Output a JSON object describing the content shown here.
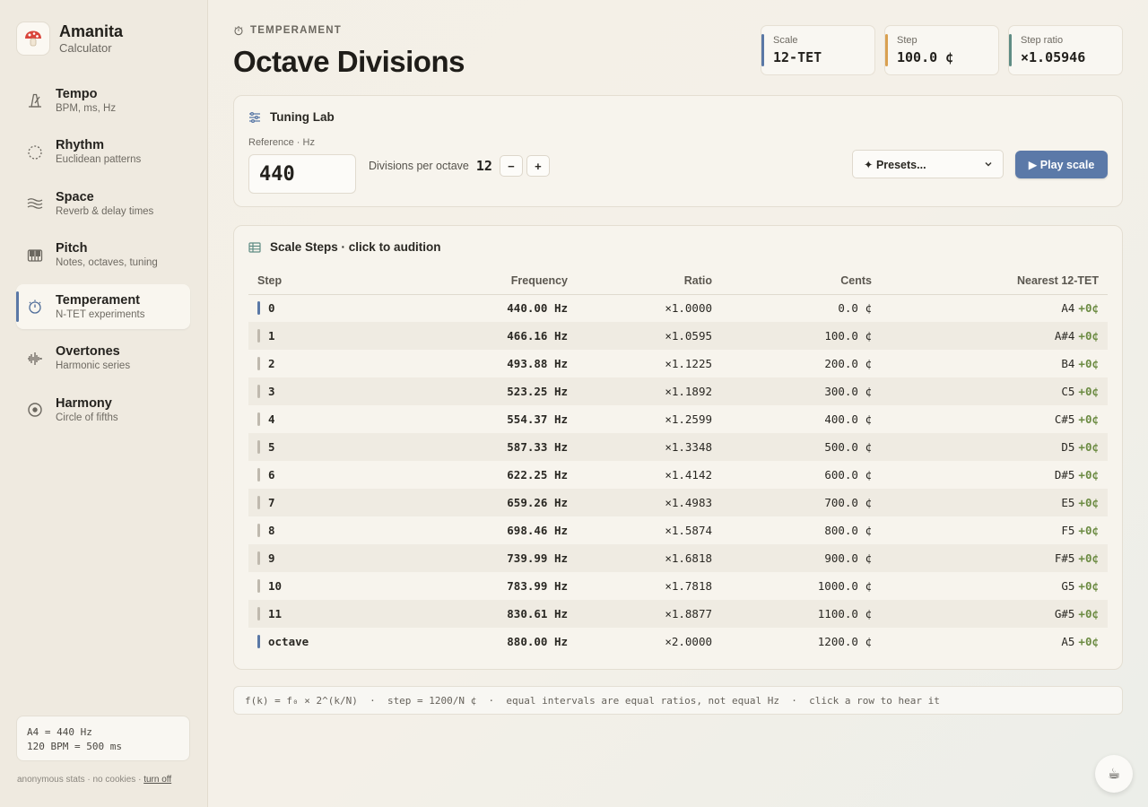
{
  "brand": {
    "name": "Amanita",
    "subtitle": "Calculator"
  },
  "nav": [
    {
      "title": "Tempo",
      "sub": "BPM, ms, Hz",
      "icon": "metronome-icon",
      "active": false
    },
    {
      "title": "Rhythm",
      "sub": "Euclidean patterns",
      "icon": "dotted-circle-icon",
      "active": false
    },
    {
      "title": "Space",
      "sub": "Reverb & delay times",
      "icon": "waves-icon",
      "active": false
    },
    {
      "title": "Pitch",
      "sub": "Notes, octaves, tuning",
      "icon": "piano-icon",
      "active": false
    },
    {
      "title": "Temperament",
      "sub": "N-TET experiments",
      "icon": "tuning-fork-dial-icon",
      "active": true
    },
    {
      "title": "Overtones",
      "sub": "Harmonic series",
      "icon": "waveform-icon",
      "active": false
    },
    {
      "title": "Harmony",
      "sub": "Circle of fifths",
      "icon": "target-icon",
      "active": false
    }
  ],
  "sidebar_info": {
    "line1": "A4 = 440 Hz",
    "line2": "120 BPM = 500 ms"
  },
  "sidebar_footer": {
    "text": "anonymous stats · no cookies · ",
    "link": "turn off"
  },
  "header": {
    "eyebrow": "TEMPERAMENT",
    "title": "Octave Divisions"
  },
  "stats": [
    {
      "label": "Scale",
      "value": "12-TET",
      "accent": "#5a78a6"
    },
    {
      "label": "Step",
      "value": "100.0 ¢",
      "accent": "#d9a050"
    },
    {
      "label": "Step ratio",
      "value": "×1.05946",
      "accent": "#5f8c84"
    }
  ],
  "lab": {
    "title": "Tuning Lab",
    "ref_label": "Reference · Hz",
    "ref_value": "440",
    "divisions_label": "Divisions per octave",
    "divisions_value": "12",
    "minus": "−",
    "plus": "+",
    "presets_label": "✦ Presets...",
    "play_label": "▶ Play scale"
  },
  "table": {
    "title": "Scale Steps · click to audition",
    "columns": [
      "Step",
      "Frequency",
      "Ratio",
      "Cents",
      "Nearest 12-TET"
    ],
    "rows": [
      {
        "step": "0",
        "freq": "440.00 Hz",
        "ratio": "×1.0000",
        "cents": "0.0 ¢",
        "note": "A4",
        "dev": "+0¢",
        "key": true
      },
      {
        "step": "1",
        "freq": "466.16 Hz",
        "ratio": "×1.0595",
        "cents": "100.0 ¢",
        "note": "A#4",
        "dev": "+0¢",
        "key": false
      },
      {
        "step": "2",
        "freq": "493.88 Hz",
        "ratio": "×1.1225",
        "cents": "200.0 ¢",
        "note": "B4",
        "dev": "+0¢",
        "key": false
      },
      {
        "step": "3",
        "freq": "523.25 Hz",
        "ratio": "×1.1892",
        "cents": "300.0 ¢",
        "note": "C5",
        "dev": "+0¢",
        "key": false
      },
      {
        "step": "4",
        "freq": "554.37 Hz",
        "ratio": "×1.2599",
        "cents": "400.0 ¢",
        "note": "C#5",
        "dev": "+0¢",
        "key": false
      },
      {
        "step": "5",
        "freq": "587.33 Hz",
        "ratio": "×1.3348",
        "cents": "500.0 ¢",
        "note": "D5",
        "dev": "+0¢",
        "key": false
      },
      {
        "step": "6",
        "freq": "622.25 Hz",
        "ratio": "×1.4142",
        "cents": "600.0 ¢",
        "note": "D#5",
        "dev": "+0¢",
        "key": false
      },
      {
        "step": "7",
        "freq": "659.26 Hz",
        "ratio": "×1.4983",
        "cents": "700.0 ¢",
        "note": "E5",
        "dev": "+0¢",
        "key": false
      },
      {
        "step": "8",
        "freq": "698.46 Hz",
        "ratio": "×1.5874",
        "cents": "800.0 ¢",
        "note": "F5",
        "dev": "+0¢",
        "key": false
      },
      {
        "step": "9",
        "freq": "739.99 Hz",
        "ratio": "×1.6818",
        "cents": "900.0 ¢",
        "note": "F#5",
        "dev": "+0¢",
        "key": false
      },
      {
        "step": "10",
        "freq": "783.99 Hz",
        "ratio": "×1.7818",
        "cents": "1000.0 ¢",
        "note": "G5",
        "dev": "+0¢",
        "key": false
      },
      {
        "step": "11",
        "freq": "830.61 Hz",
        "ratio": "×1.8877",
        "cents": "1100.0 ¢",
        "note": "G#5",
        "dev": "+0¢",
        "key": false
      },
      {
        "step": "octave",
        "freq": "880.00 Hz",
        "ratio": "×2.0000",
        "cents": "1200.0 ¢",
        "note": "A5",
        "dev": "+0¢",
        "key": true
      }
    ]
  },
  "formula": "f(k) = f₀ × 2^(k/N)  ·  step = 1200/N ¢  ·  equal intervals are equal ratios, not equal Hz  ·  click a row to hear it",
  "coffee": "☕"
}
